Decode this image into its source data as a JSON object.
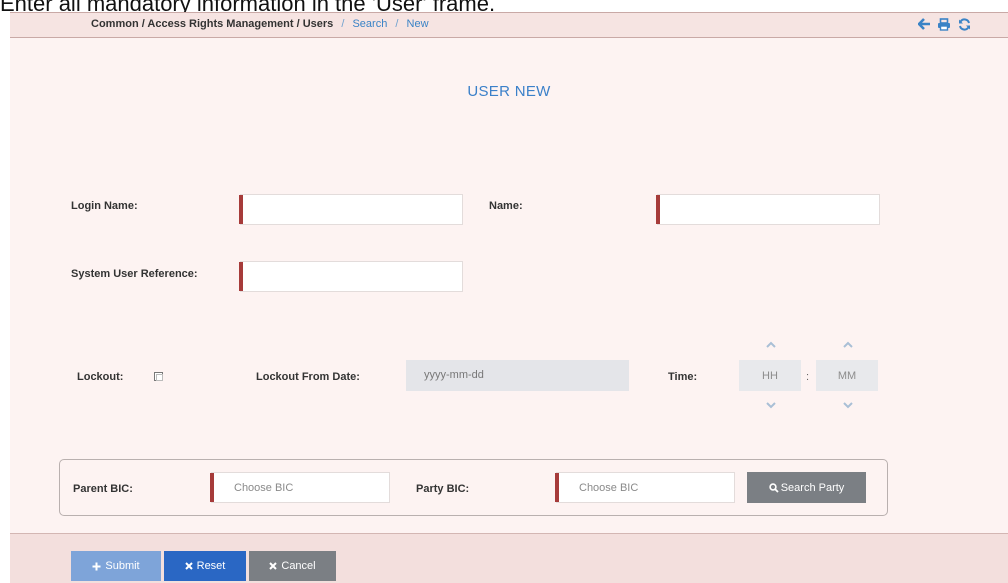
{
  "caption": "Enter all mandatory information in the 'User' frame.",
  "breadcrumb": {
    "path": "Common / Access Rights Management / Users",
    "separator": "/",
    "search": "Search",
    "current": "New"
  },
  "toolbar": {
    "icons": [
      "back-arrow-icon",
      "print-icon",
      "refresh-icon"
    ],
    "color": "#3a83c6"
  },
  "page": {
    "title": "USER NEW"
  },
  "form": {
    "login_name_label": "Login Name:",
    "login_name_value": "",
    "name_label": "Name:",
    "name_value": "",
    "system_user_reference_label": "System User Reference:",
    "system_user_reference_value": "",
    "lockout_label": "Lockout:",
    "lockout_checked": false,
    "lockout_from_date_label": "Lockout From Date:",
    "lockout_from_date_placeholder": "yyyy-mm-dd",
    "time_label": "Time:",
    "time_hours_placeholder": "HH",
    "time_separator": ":",
    "time_minutes_placeholder": "MM"
  },
  "bic": {
    "parent_bic_label": "Parent BIC:",
    "parent_bic_placeholder": "Choose BIC",
    "party_bic_label": "Party BIC:",
    "party_bic_placeholder": "Choose BIC",
    "search_party_label": "Search Party"
  },
  "actions": {
    "submit_label": "Submit",
    "reset_label": "Reset",
    "cancel_label": "Cancel"
  },
  "colors": {
    "accent": "#3b80c9",
    "required_marker": "#a63b3a",
    "panel_background": "#fdf3f2"
  }
}
